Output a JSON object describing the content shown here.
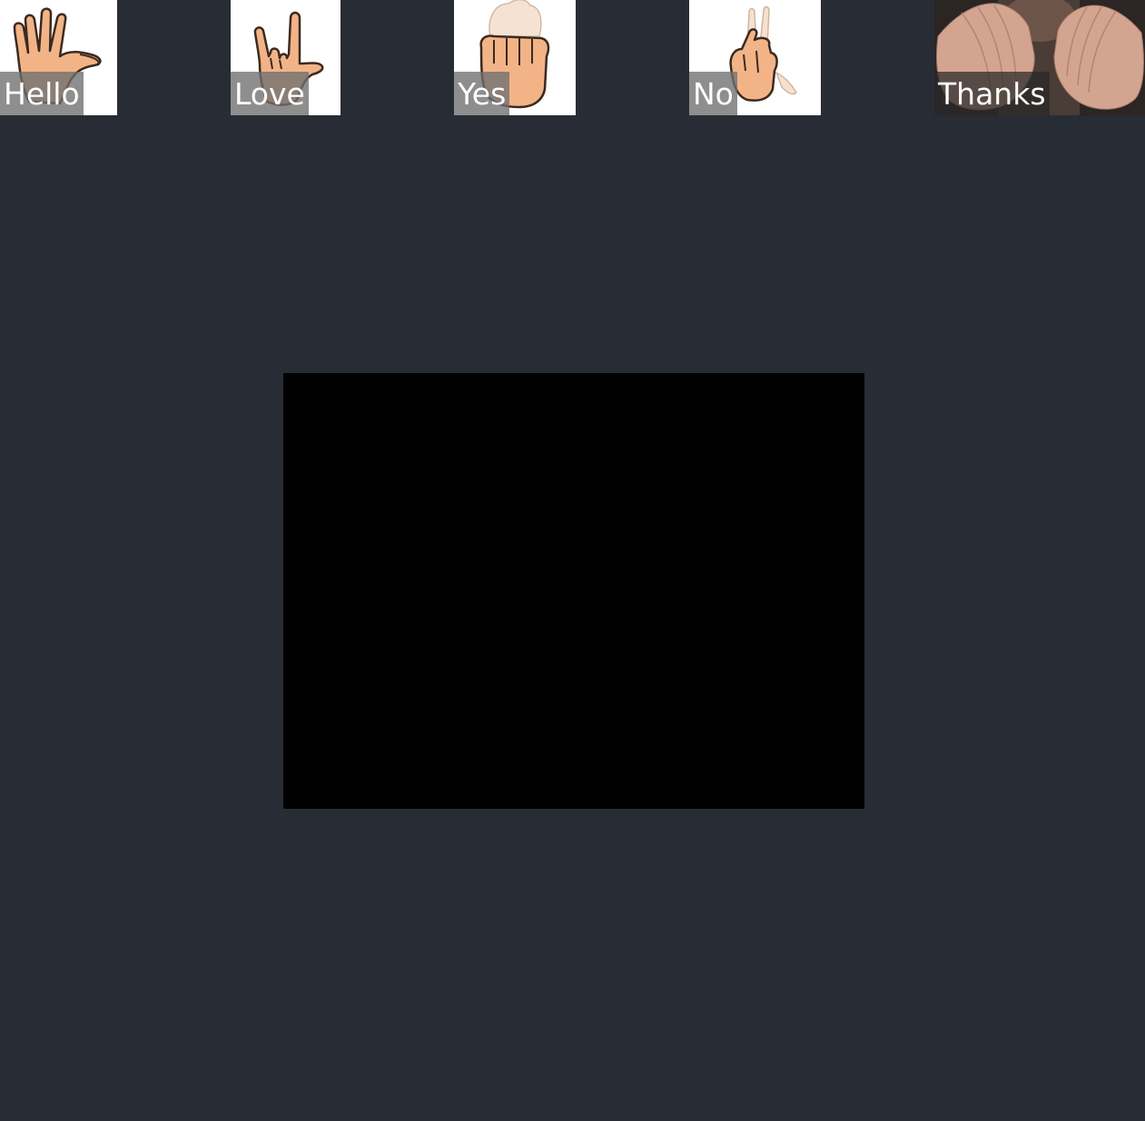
{
  "signs": [
    {
      "label": "Hello",
      "icon": "open-hand-icon"
    },
    {
      "label": "Love",
      "icon": "i-love-you-hand-icon"
    },
    {
      "label": "Yes",
      "icon": "fist-hand-icon"
    },
    {
      "label": "No",
      "icon": "two-finger-snap-hand-icon"
    },
    {
      "label": "Thanks",
      "icon": "hands-over-mouth-photo"
    }
  ],
  "colors": {
    "background": "#282c35",
    "card_background": "#ffffff",
    "label_background": "#6e6e6e",
    "label_text": "#ffffff",
    "skin": "#f2b487",
    "video_background": "#000000"
  }
}
